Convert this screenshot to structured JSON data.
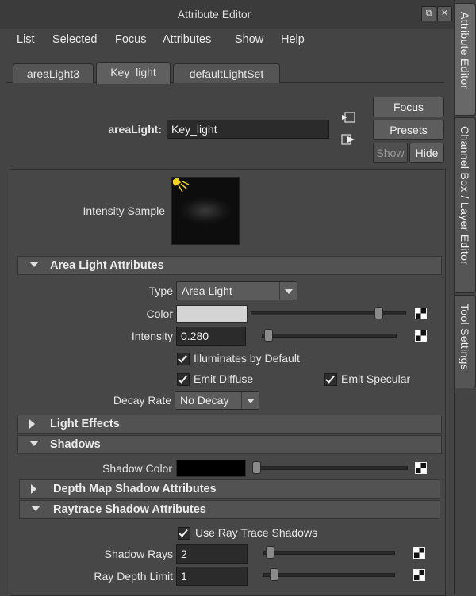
{
  "window": {
    "title": "Attribute Editor"
  },
  "menu": [
    "List",
    "Selected",
    "Focus",
    "Attributes",
    "Show",
    "Help"
  ],
  "tabs": [
    {
      "label": "areaLight3",
      "active": false
    },
    {
      "label": "Key_light",
      "active": true
    },
    {
      "label": "defaultLightSet",
      "active": false
    }
  ],
  "node": {
    "label": "areaLight:",
    "value": "Key_light"
  },
  "buttons": {
    "focus": "Focus",
    "presets": "Presets",
    "show": "Show",
    "hide": "Hide"
  },
  "sample": {
    "label": "Intensity Sample"
  },
  "sections": {
    "area_light": "Area Light Attributes",
    "light_effects": "Light Effects",
    "shadows": "Shadows",
    "depth_map": "Depth Map Shadow Attributes",
    "raytrace": "Raytrace Shadow Attributes"
  },
  "area": {
    "type_label": "Type",
    "type_value": "Area Light",
    "color_label": "Color",
    "color_value": "#d4d4d4",
    "color_slider": 0.85,
    "intensity_label": "Intensity",
    "intensity_value": "0.280",
    "intensity_slider": 0.02,
    "illuminates_label": "Illuminates by Default",
    "illuminates": true,
    "emit_diffuse_label": "Emit Diffuse",
    "emit_diffuse": true,
    "emit_specular_label": "Emit Specular",
    "emit_specular": true,
    "decay_label": "Decay Rate",
    "decay_value": "No Decay"
  },
  "shadows": {
    "color_label": "Shadow Color",
    "color_value": "#000000",
    "color_slider": 0.0
  },
  "raytrace": {
    "use_label": "Use Ray Trace Shadows",
    "use": true,
    "rays_label": "Shadow Rays",
    "rays_value": "2",
    "rays_slider": 0.02,
    "depth_label": "Ray Depth Limit",
    "depth_value": "1",
    "depth_slider": 0.05
  },
  "side_tabs": [
    {
      "label": "Attribute Editor",
      "active": true
    },
    {
      "label": "Channel Box / Layer Editor",
      "active": false
    },
    {
      "label": "Tool Settings",
      "active": false
    }
  ]
}
